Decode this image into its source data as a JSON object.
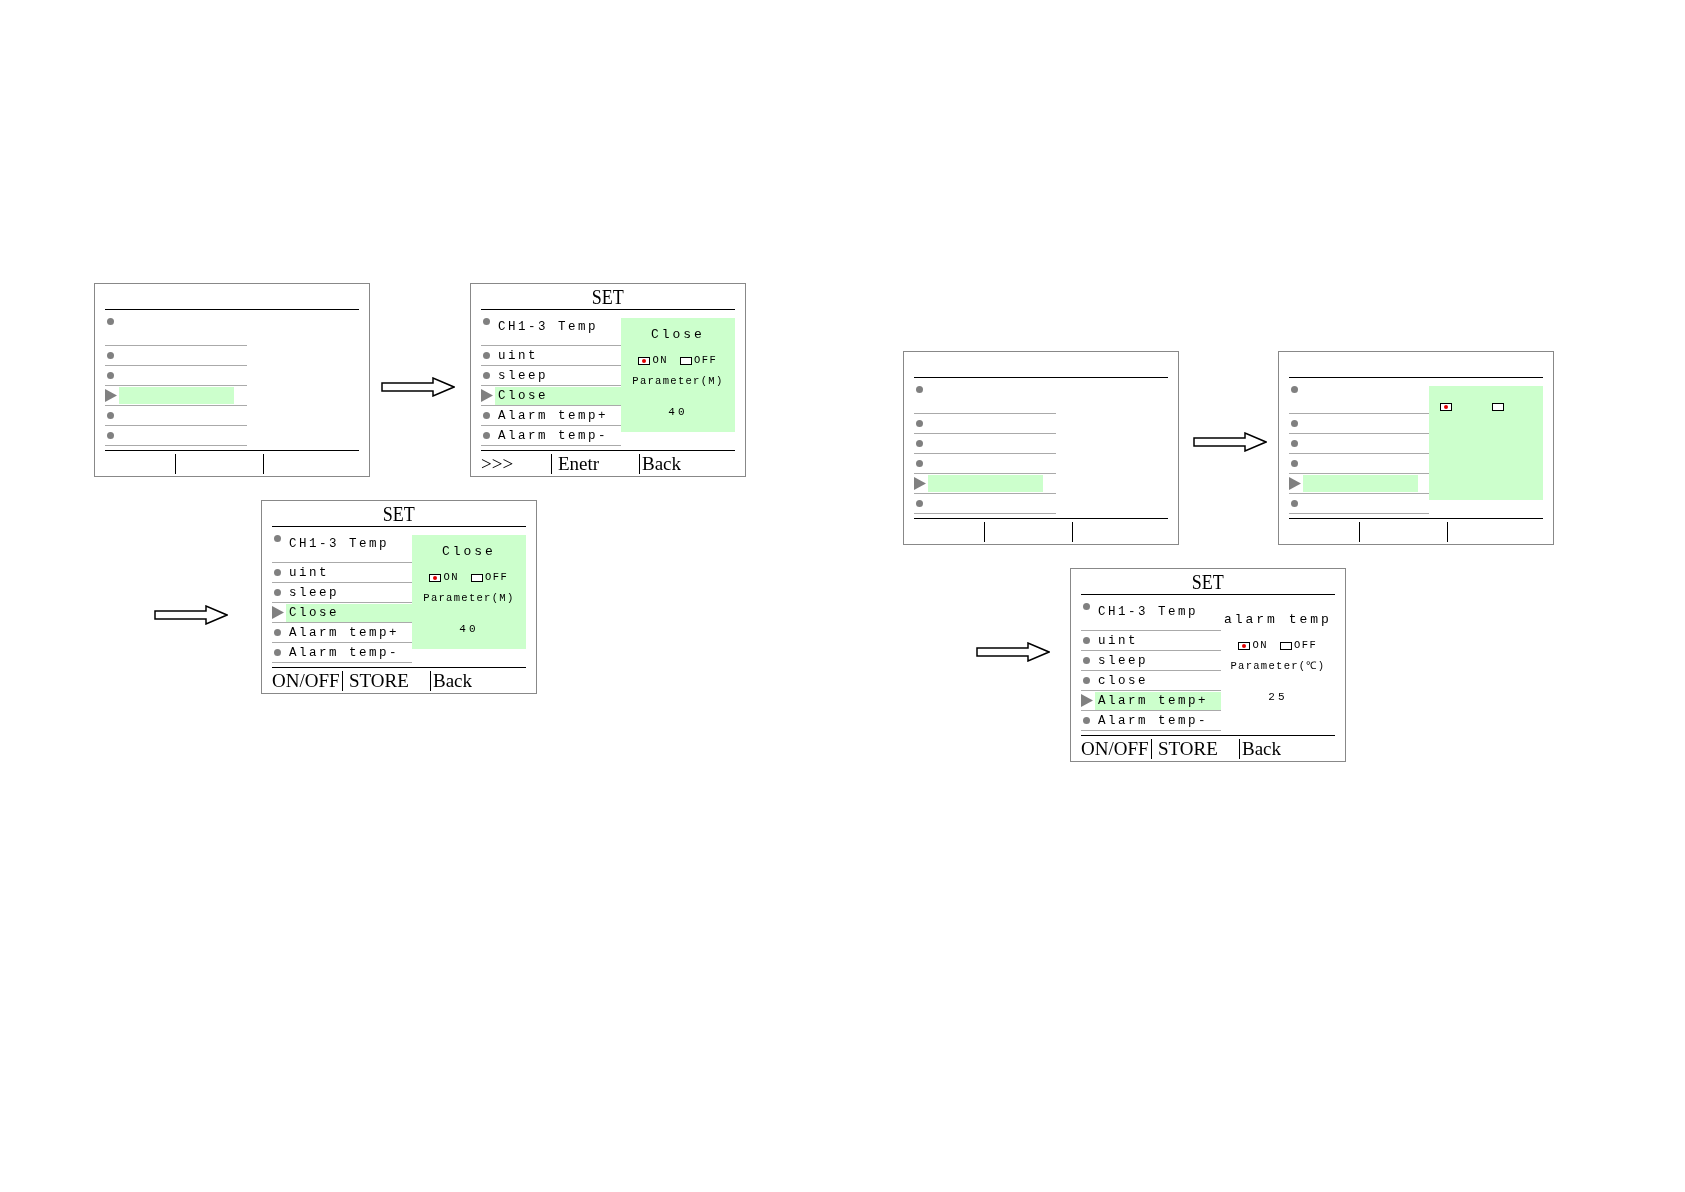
{
  "screens": [
    {
      "items": [
        {
          "selected": false
        },
        {
          "selected": false
        },
        {
          "selected": false
        },
        {
          "selected": true
        },
        {
          "selected": false
        },
        {
          "selected": false
        }
      ]
    },
    {
      "title": "SET",
      "items": [
        {
          "label": "CH1-3 Temp",
          "selected": false
        },
        {
          "label": "uint",
          "selected": false
        },
        {
          "label": "sleep",
          "selected": false
        },
        {
          "label": "Close",
          "selected": true
        },
        {
          "label": "Alarm temp+",
          "selected": false
        },
        {
          "label": "Alarm temp-",
          "selected": false
        }
      ],
      "panel": {
        "shaded": true,
        "heading": "Close",
        "options": [
          {
            "label": "ON",
            "selected": true
          },
          {
            "label": "OFF",
            "selected": false
          }
        ],
        "parameter_label": "Parameter(M)",
        "value": "40"
      },
      "softkeys": [
        ">>>",
        "Enetr",
        "Back"
      ]
    },
    {
      "title": "SET",
      "items": [
        {
          "label": "CH1-3 Temp",
          "selected": false
        },
        {
          "label": "uint",
          "selected": false
        },
        {
          "label": "sleep",
          "selected": false
        },
        {
          "label": "Close",
          "selected": true
        },
        {
          "label": "Alarm temp+",
          "selected": false
        },
        {
          "label": "Alarm temp-",
          "selected": false
        }
      ],
      "panel": {
        "shaded": true,
        "heading": "Close",
        "options": [
          {
            "label": "ON",
            "selected": true
          },
          {
            "label": "OFF",
            "selected": false
          }
        ],
        "parameter_label": "Parameter(M)",
        "value": "40"
      },
      "softkeys": [
        "ON/OFF",
        "STORE",
        "Back"
      ]
    },
    {
      "items": [
        {
          "selected": false
        },
        {
          "selected": false
        },
        {
          "selected": false
        },
        {
          "selected": false
        },
        {
          "selected": true
        },
        {
          "selected": false
        }
      ]
    },
    {
      "items": [
        {
          "selected": false
        },
        {
          "selected": false
        },
        {
          "selected": false
        },
        {
          "selected": false
        },
        {
          "selected": true
        },
        {
          "selected": false
        }
      ],
      "panel": {
        "shaded": true,
        "options": [
          {
            "selected": true
          },
          {
            "selected": false
          }
        ]
      }
    },
    {
      "title": "SET",
      "items": [
        {
          "label": "CH1-3 Temp",
          "selected": false
        },
        {
          "label": "uint",
          "selected": false
        },
        {
          "label": "sleep",
          "selected": false
        },
        {
          "label": "close",
          "selected": false
        },
        {
          "label": "Alarm temp+",
          "selected": true
        },
        {
          "label": "Alarm temp-",
          "selected": false
        }
      ],
      "panel": {
        "shaded": false,
        "heading": "alarm temp",
        "options": [
          {
            "label": "ON",
            "selected": true
          },
          {
            "label": "OFF",
            "selected": false
          }
        ],
        "parameter_label": "Parameter(℃)",
        "value": "25"
      },
      "softkeys": [
        "ON/OFF",
        "STORE",
        "Back"
      ]
    }
  ]
}
